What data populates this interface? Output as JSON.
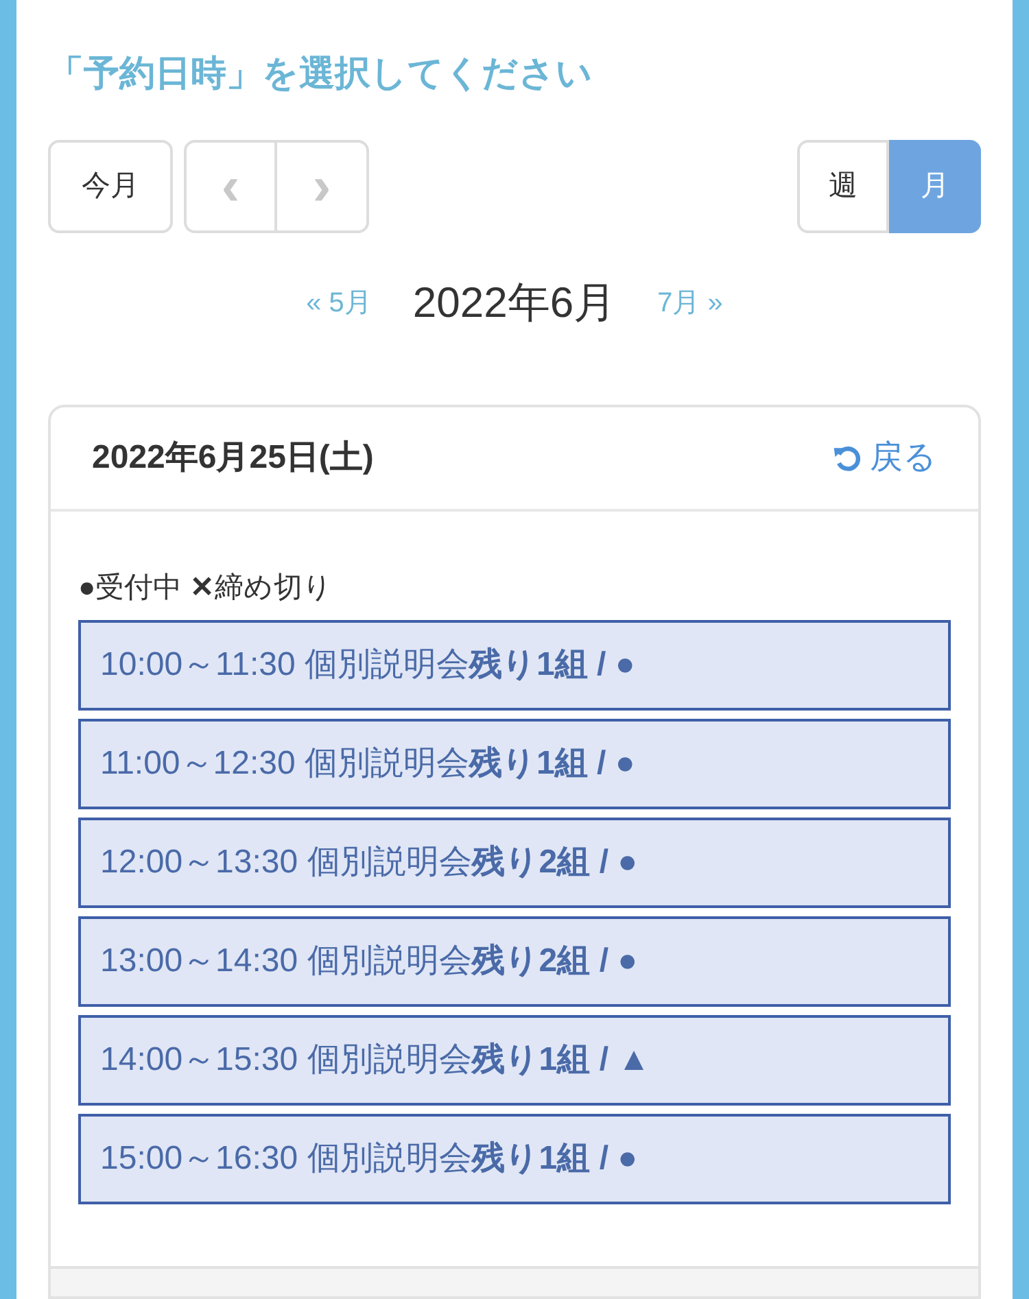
{
  "heading": "「予約日時」を選択してください",
  "toolbar": {
    "today": "今月",
    "prev": "‹",
    "next": "›"
  },
  "views": [
    {
      "label": "週",
      "selected": false
    },
    {
      "label": "月",
      "selected": true
    }
  ],
  "month_nav": {
    "prev_mark": "«",
    "prev": "5月",
    "next_mark": "»",
    "current": "2022年6月",
    "next": "7月"
  },
  "day_panel": {
    "date": "2022年6月25日(土)",
    "back": "戻る",
    "legend": "**●**受付中 **✕**締め切り",
    "slots": [
      {
        "text": "10:00～11:30 個別説明会 **残り1組 / ●**"
      },
      {
        "text": "11:00～12:30 個別説明会 **残り1組 / ●**"
      },
      {
        "text": "12:00～13:30 個別説明会 **残り2組 / ●**"
      },
      {
        "text": "13:00～14:30 個別説明会 **残り2組 / ●**"
      },
      {
        "text": "14:00～15:30 個別説明会 **残り1組 / ▲**"
      },
      {
        "text": "15:00～16:30 個別説明会 **残り1組 / ●**"
      }
    ]
  }
}
